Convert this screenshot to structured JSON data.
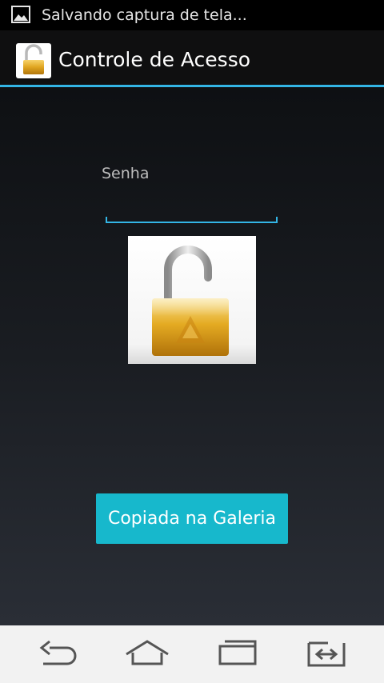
{
  "status_bar": {
    "icon": "image-icon",
    "notification_text": "Salvando captura de tela..."
  },
  "action_bar": {
    "icon": "padlock-icon",
    "title": "Controle de Acesso",
    "accent_color": "#33b5e5"
  },
  "form": {
    "password_label": "Senha",
    "password_value": "",
    "lock_image": "open-padlock-image"
  },
  "button": {
    "label": "Copiada na Galeria",
    "color": "#17b8cc"
  },
  "nav_bar": {
    "back_icon": "back-icon",
    "home_icon": "home-icon",
    "recents_icon": "recent-apps-icon",
    "switch_icon": "switch-apps-icon"
  }
}
